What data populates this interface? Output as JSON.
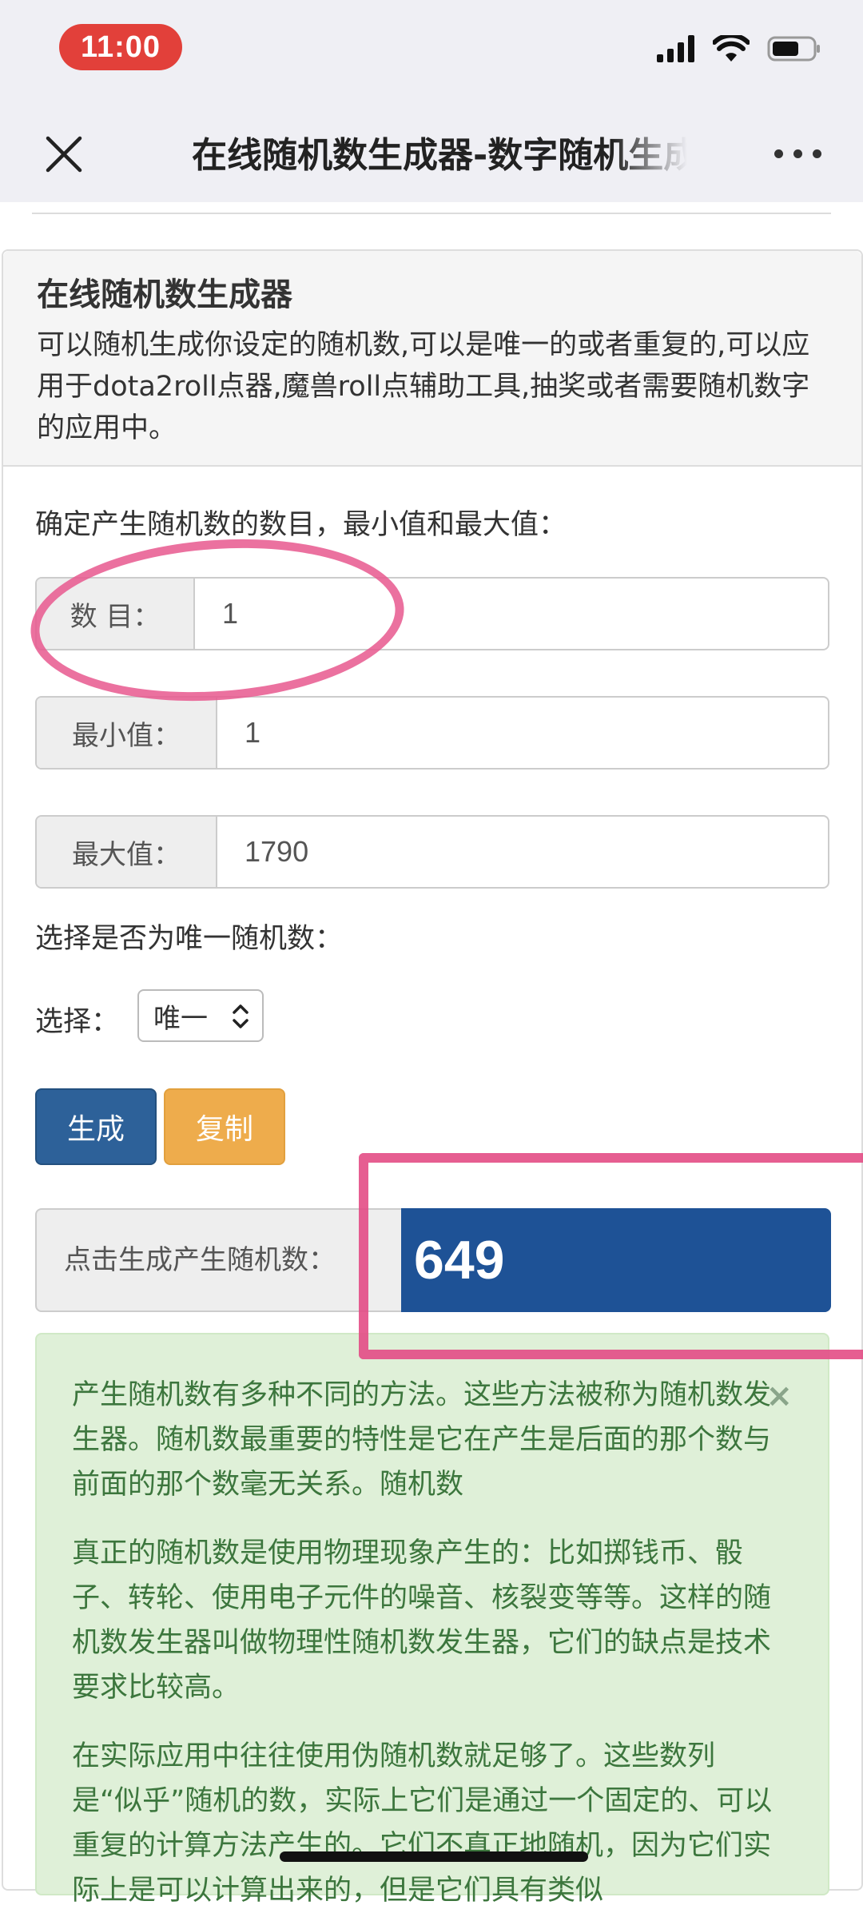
{
  "status_bar": {
    "time": "11:00"
  },
  "nav": {
    "title": "在线随机数生成器-数字随机生成器"
  },
  "panel": {
    "title": "在线随机数生成器",
    "description": "可以随机生成你设定的随机数,可以是唯一的或者重复的,可以应用于dota2roll点器,魔兽roll点辅助工具,抽奖或者需要随机数字的应用中。",
    "range_prompt": "确定产生随机数的数目，最小值和最大值：",
    "count": {
      "label": "数  目：",
      "value": "1"
    },
    "min": {
      "label": "最小值：",
      "value": "1"
    },
    "max": {
      "label": "最大值：",
      "value": "1790"
    },
    "unique_prompt": "选择是否为唯一随机数：",
    "select": {
      "label": "选择：",
      "value": "唯一"
    },
    "buttons": {
      "generate": "生成",
      "copy": "复制"
    },
    "result": {
      "label": "点击生成产生随机数：",
      "value": "649"
    },
    "alert": {
      "close": "×",
      "p1": "产生随机数有多种不同的方法。这些方法被称为随机数发生器。随机数最重要的特性是它在产生是后面的那个数与前面的那个数毫无关系。随机数",
      "p2": "真正的随机数是使用物理现象产生的：比如掷钱币、骰子、转轮、使用电子元件的噪音、核裂变等等。这样的随机数发生器叫做物理性随机数发生器，它们的缺点是技术要求比较高。",
      "p3": "在实际应用中往往使用伪随机数就足够了。这些数列是“似乎”随机的数，实际上它们是通过一个固定的、可以重复的计算方法产生的。它们不真正地随机，因为它们实际上是可以计算出来的，但是它们具有类似"
    }
  },
  "colors": {
    "primary_button": "#2d6199",
    "warning_button": "#eeac4c",
    "result_bg": "#1e5296",
    "alert_bg": "#dff0d8",
    "alert_text": "#3c763d",
    "annotation": "#e8588e",
    "time_pill": "#e2403a"
  }
}
